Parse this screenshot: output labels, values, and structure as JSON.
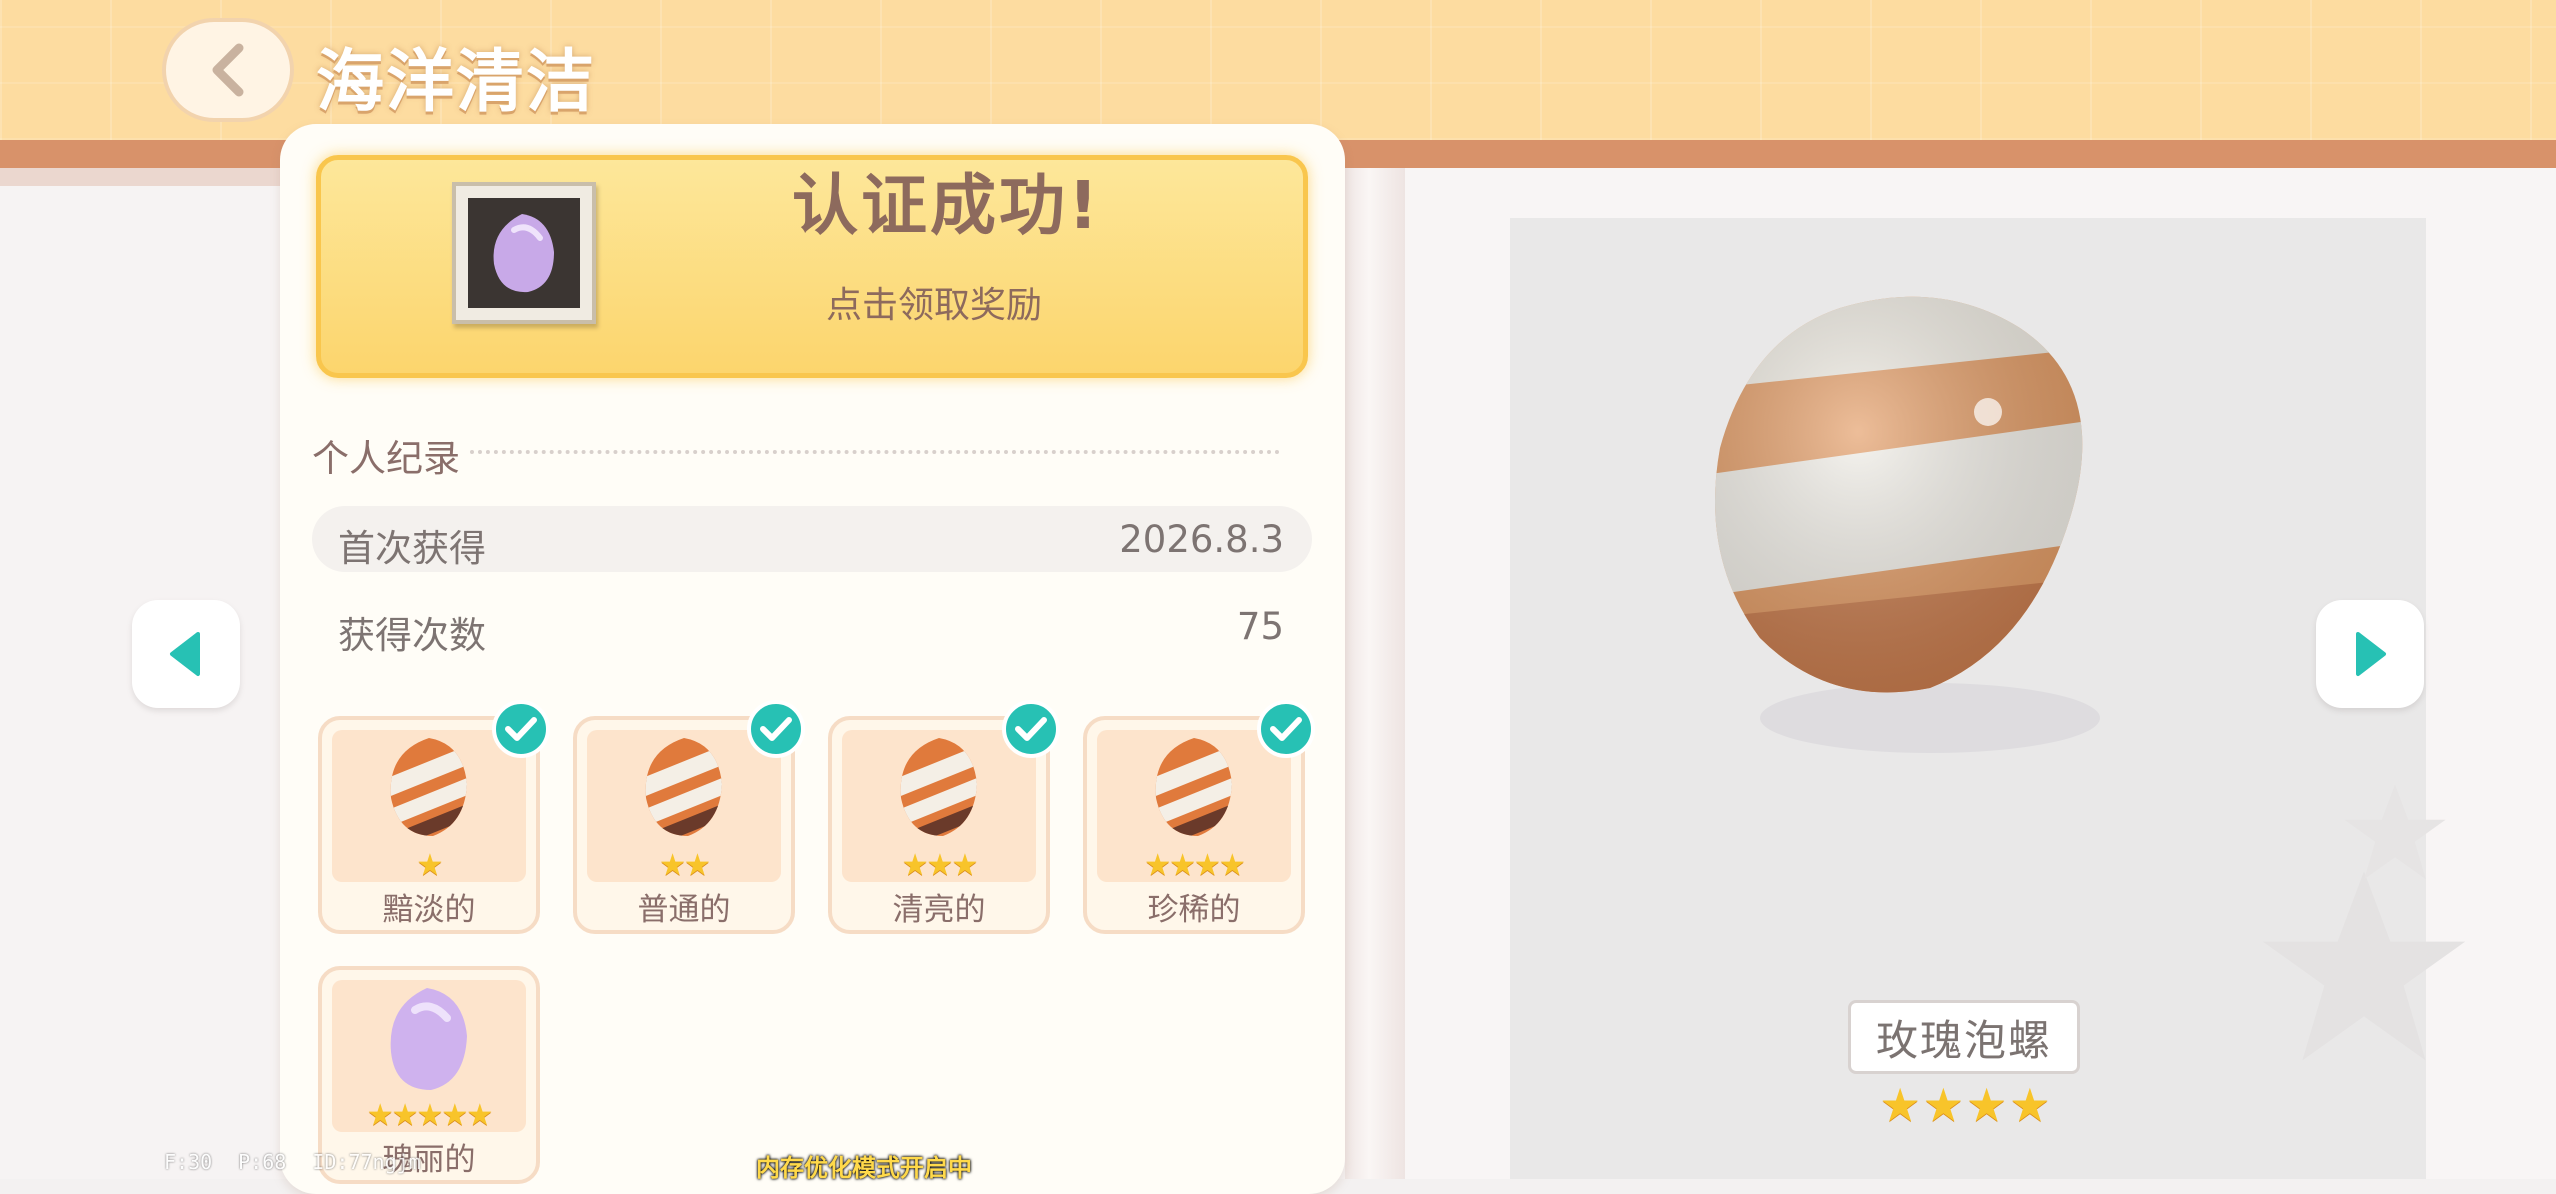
{
  "header": {
    "title": "海洋清洁",
    "back_icon": "chevron-left-icon"
  },
  "certification": {
    "title": "认证成功!",
    "subtitle": "点击领取奖励"
  },
  "records": {
    "section_title": "个人纪录",
    "first_obtained_label": "首次获得",
    "first_obtained_value": "2026.8.3",
    "count_label": "获得次数",
    "count_value": "75"
  },
  "qualities": [
    {
      "label": "黯淡的",
      "stars": "★",
      "star_count": 1,
      "checked": true
    },
    {
      "label": "普通的",
      "stars": "★★",
      "star_count": 2,
      "checked": true
    },
    {
      "label": "清亮的",
      "stars": "★★★",
      "star_count": 3,
      "checked": true
    },
    {
      "label": "珍稀的",
      "stars": "★★★★",
      "star_count": 4,
      "checked": true
    },
    {
      "label": "瑰丽的",
      "stars": "★★★★★",
      "star_count": 5,
      "checked": false
    }
  ],
  "preview": {
    "item_name": "玫瑰泡螺",
    "stars": "★★★★",
    "star_count": 4
  },
  "debug": {
    "f": "F:30",
    "p": "P:68",
    "id": "ID:77ngjm"
  },
  "notice": "内存优化模式开启中",
  "colors": {
    "accent_teal": "#27c1b4",
    "banner_yellow": "#fcd56d",
    "header_orange": "#fddca0",
    "star_gold": "#f8c42a"
  }
}
